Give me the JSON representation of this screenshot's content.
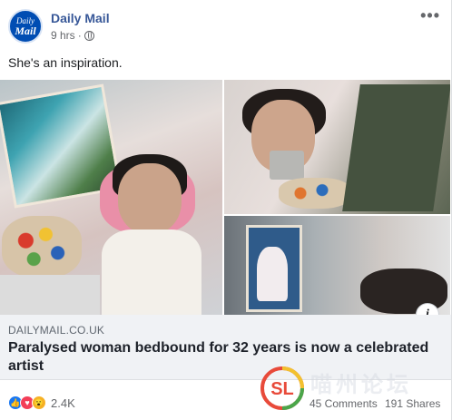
{
  "post": {
    "page_name": "Daily Mail",
    "avatar_line1": "Daily",
    "avatar_line2": "Mail",
    "time": "9 hrs",
    "separator": "·",
    "privacy_icon": "globe-icon",
    "more_label": "•••",
    "text": "She's an inspiration."
  },
  "photos": {
    "info_label": "i"
  },
  "link_preview": {
    "domain": "DAILYMAIL.CO.UK",
    "title": "Paralysed woman bedbound for 32 years is now a celebrated artist"
  },
  "engagement": {
    "reaction_icons": [
      "like-icon",
      "love-icon",
      "wow-icon"
    ],
    "reaction_glyphs": [
      "👍",
      "♥",
      "😮"
    ],
    "reaction_count": "2.4K",
    "comments": "45 Comments",
    "shares": "191 Shares"
  },
  "watermark": {
    "logo_text": "SL",
    "text": "喵州论坛"
  },
  "colors": {
    "page_name": "#385898",
    "like": "#1877f2",
    "love": "#f33e58",
    "wow": "#f7b125",
    "link_box_bg": "#f0f2f5"
  }
}
